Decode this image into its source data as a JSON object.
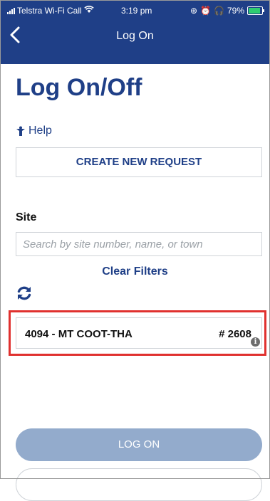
{
  "status_bar": {
    "carrier": "Telstra Wi-Fi Call",
    "time": "3:19 pm",
    "battery": "79%",
    "battery_level": 0.79
  },
  "nav": {
    "title": "Log On",
    "back_icon": "chevron-left-icon"
  },
  "page": {
    "title": "Log On/Off"
  },
  "help": {
    "label": "Help",
    "icon": "help-figure-icon"
  },
  "actions": {
    "create_new_request": "CREATE NEW REQUEST",
    "log_on": "LOG ON"
  },
  "site": {
    "label": "Site",
    "placeholder": "Search by site number, name, or town",
    "clear_filters": "Clear Filters",
    "refresh_icon": "refresh-icon"
  },
  "site_results": [
    {
      "name": "4094 - MT COOT-THA",
      "number": "# 2608"
    }
  ],
  "colors": {
    "primary": "#1f3f87",
    "disabled_button": "#93abcc",
    "highlight": "#e0312f",
    "battery_fill": "#2ecc71"
  }
}
